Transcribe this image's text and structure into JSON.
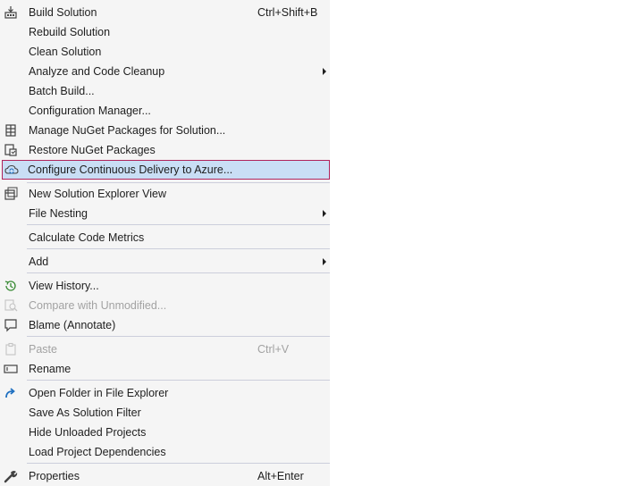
{
  "menu": {
    "items": [
      {
        "label": "Build Solution",
        "shortcut": "Ctrl+Shift+B",
        "icon": "build-icon"
      },
      {
        "label": "Rebuild Solution"
      },
      {
        "label": "Clean Solution"
      },
      {
        "label": "Analyze and Code Cleanup",
        "submenu": true
      },
      {
        "label": "Batch Build..."
      },
      {
        "label": "Configuration Manager..."
      },
      {
        "label": "Manage NuGet Packages for Solution...",
        "icon": "nuget-package-icon"
      },
      {
        "label": "Restore NuGet Packages",
        "icon": "restore-packages-icon"
      },
      {
        "label": "Configure Continuous Delivery to Azure...",
        "icon": "cloud-sync-icon",
        "selected": true
      },
      {
        "label": "New Solution Explorer View",
        "icon": "new-window-icon"
      },
      {
        "label": "File Nesting",
        "submenu": true
      },
      {
        "label": "Calculate Code Metrics"
      },
      {
        "label": "Add",
        "submenu": true
      },
      {
        "label": "View History...",
        "icon": "history-icon"
      },
      {
        "label": "Compare with Unmodified...",
        "icon": "compare-icon",
        "disabled": true
      },
      {
        "label": "Blame (Annotate)",
        "icon": "comment-icon"
      },
      {
        "label": "Paste",
        "shortcut": "Ctrl+V",
        "icon": "paste-icon",
        "disabled": true
      },
      {
        "label": "Rename",
        "icon": "rename-icon"
      },
      {
        "label": "Open Folder in File Explorer",
        "icon": "open-folder-arrow-icon"
      },
      {
        "label": "Save As Solution Filter"
      },
      {
        "label": "Hide Unloaded Projects"
      },
      {
        "label": "Load Project Dependencies"
      },
      {
        "label": "Properties",
        "shortcut": "Alt+Enter",
        "icon": "wrench-icon"
      }
    ]
  },
  "colors": {
    "menu_background": "#f5f5f5",
    "selected_background": "#c9def5",
    "selected_border": "#b0235b",
    "separator": "#cccedb",
    "text": "#1e1e1e",
    "disabled_text": "#a2a2a2"
  }
}
